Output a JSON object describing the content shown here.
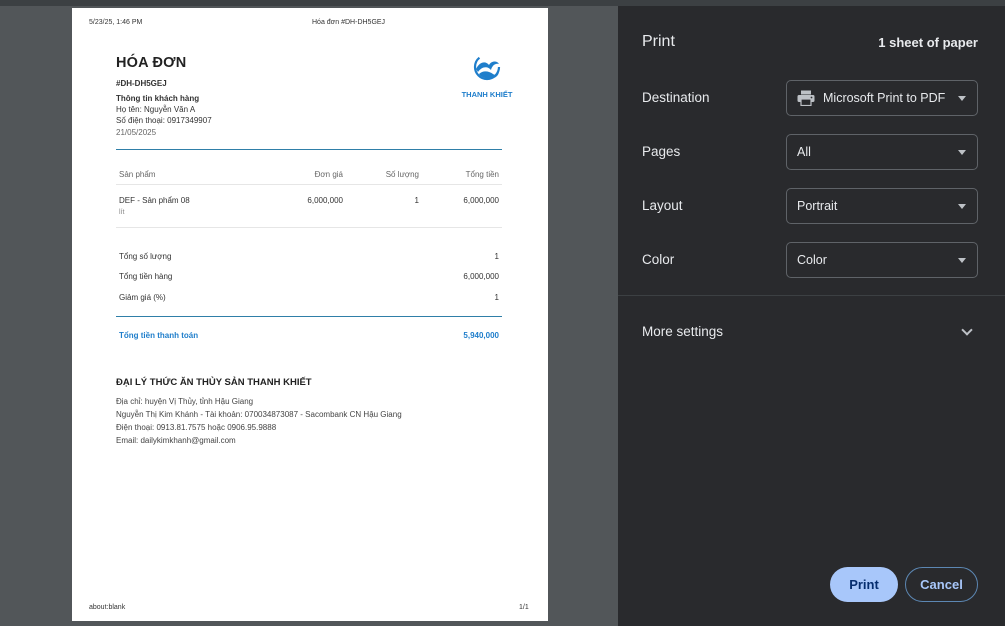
{
  "page": {
    "header_datetime": "5/23/25, 1:46 PM",
    "header_title": "Hóa đơn #DH-DH5GEJ",
    "footer_url": "about:blank",
    "footer_page": "1/1"
  },
  "invoice": {
    "title": "HÓA ĐƠN",
    "code": "#DH-DH5GEJ",
    "customer_heading": "Thông tin khách hàng",
    "customer_name": "Họ tên: Nguyễn Văn A",
    "customer_phone": "Số điện thoại: 0917349907",
    "date": "21/05/2025",
    "brand": "THANH KHIẾT",
    "table": {
      "headers": [
        "Sản phẩm",
        "Đơn giá",
        "Số lượng",
        "Tổng tiền"
      ],
      "rows": [
        {
          "product": "DEF - Sản phẩm 08",
          "unit": "lít",
          "price": "6,000,000",
          "qty": "1",
          "total": "6,000,000"
        }
      ]
    },
    "summary": [
      {
        "label": "Tổng số lượng",
        "value": "1"
      },
      {
        "label": "Tổng tiền hàng",
        "value": "6,000,000"
      },
      {
        "label": "Giảm giá (%)",
        "value": "1"
      }
    ],
    "grand_total_label": "Tổng tiền thanh toán",
    "grand_total_value": "5,940,000",
    "company": {
      "name": "ĐẠI LÝ THỨC ĂN THỦY SẢN THANH KHIẾT",
      "address": "Địa chỉ: huyện Vị Thủy, tỉnh Hậu Giang",
      "bank": "Nguyễn Thị Kim Khánh - Tài khoản: 070034873087 - Sacombank CN Hậu Giang",
      "phone": "Điện thoại: 0913.81.7575 hoặc 0906.95.9888",
      "email": "Email: dailykimkhanh@gmail.com"
    }
  },
  "panel": {
    "title": "Print",
    "sheets": "1 sheet of paper",
    "destination_label": "Destination",
    "destination_value": "Microsoft Print to PDF",
    "pages_label": "Pages",
    "pages_value": "All",
    "layout_label": "Layout",
    "layout_value": "Portrait",
    "color_label": "Color",
    "color_value": "Color",
    "more_settings": "More settings",
    "print_button": "Print",
    "cancel_button": "Cancel"
  },
  "icons": {
    "printer": "printer-icon",
    "dropdown": "chevron-down-icon",
    "logo": "wave-logo-icon"
  },
  "colors": {
    "accent": "#a8c7fa",
    "brand_blue": "#1f7ecb",
    "panel_bg": "#292a2d",
    "preview_bg": "#525659"
  }
}
